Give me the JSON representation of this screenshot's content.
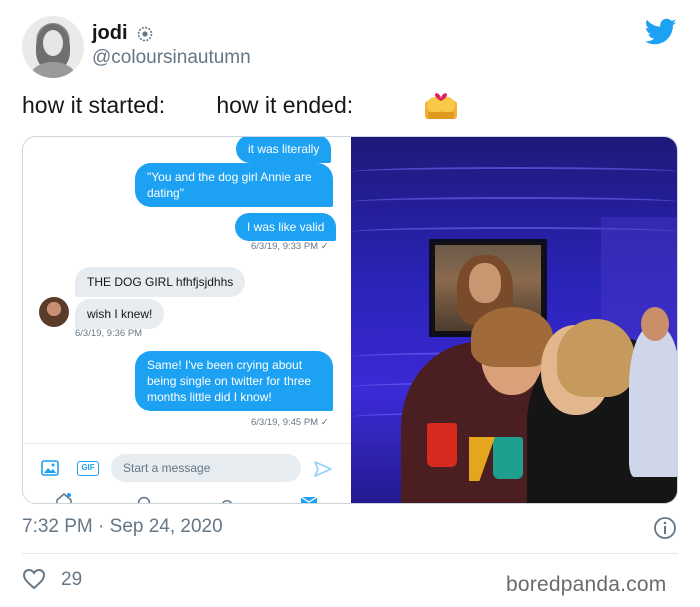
{
  "user": {
    "name": "jodi",
    "handle": "@coloursinautumn"
  },
  "tweet": {
    "text_started": "how it started:",
    "text_ended": "how it ended:",
    "timestamp": "7:32 PM · Sep 24, 2020",
    "likes": "29"
  },
  "dm": {
    "messages": [
      {
        "dir": "out",
        "text": "it was literally"
      },
      {
        "dir": "out",
        "text": "\"You and the dog girl Annie are dating\""
      },
      {
        "dir": "out",
        "text": "I was like valid"
      },
      {
        "dir": "stamp_out",
        "text": "6/3/19, 9:33 PM ✓"
      },
      {
        "dir": "in",
        "text": "THE DOG GIRL hfhfjsjdhhs"
      },
      {
        "dir": "in",
        "text": "wish I knew!"
      },
      {
        "dir": "stamp_in",
        "text": "6/3/19, 9:36 PM"
      },
      {
        "dir": "out",
        "text": "Same! I've been crying about being single on twitter for three months little did I know!"
      },
      {
        "dir": "stamp_out",
        "text": "6/3/19, 9:45 PM ✓"
      }
    ],
    "composer_placeholder": "Start a message",
    "gif_label": "GIF"
  },
  "watermark": "boredpanda.com",
  "colors": {
    "twitter_blue": "#1da1f2",
    "text_gray": "#657786",
    "bubble_gray": "#e6ecf0"
  },
  "icons": [
    "verified-badge-icon",
    "twitter-bird-icon",
    "kiss-emoji-icon",
    "image-icon",
    "gif-icon",
    "send-icon",
    "home-icon",
    "search-icon",
    "notifications-icon",
    "mail-icon",
    "info-icon",
    "heart-icon"
  ]
}
